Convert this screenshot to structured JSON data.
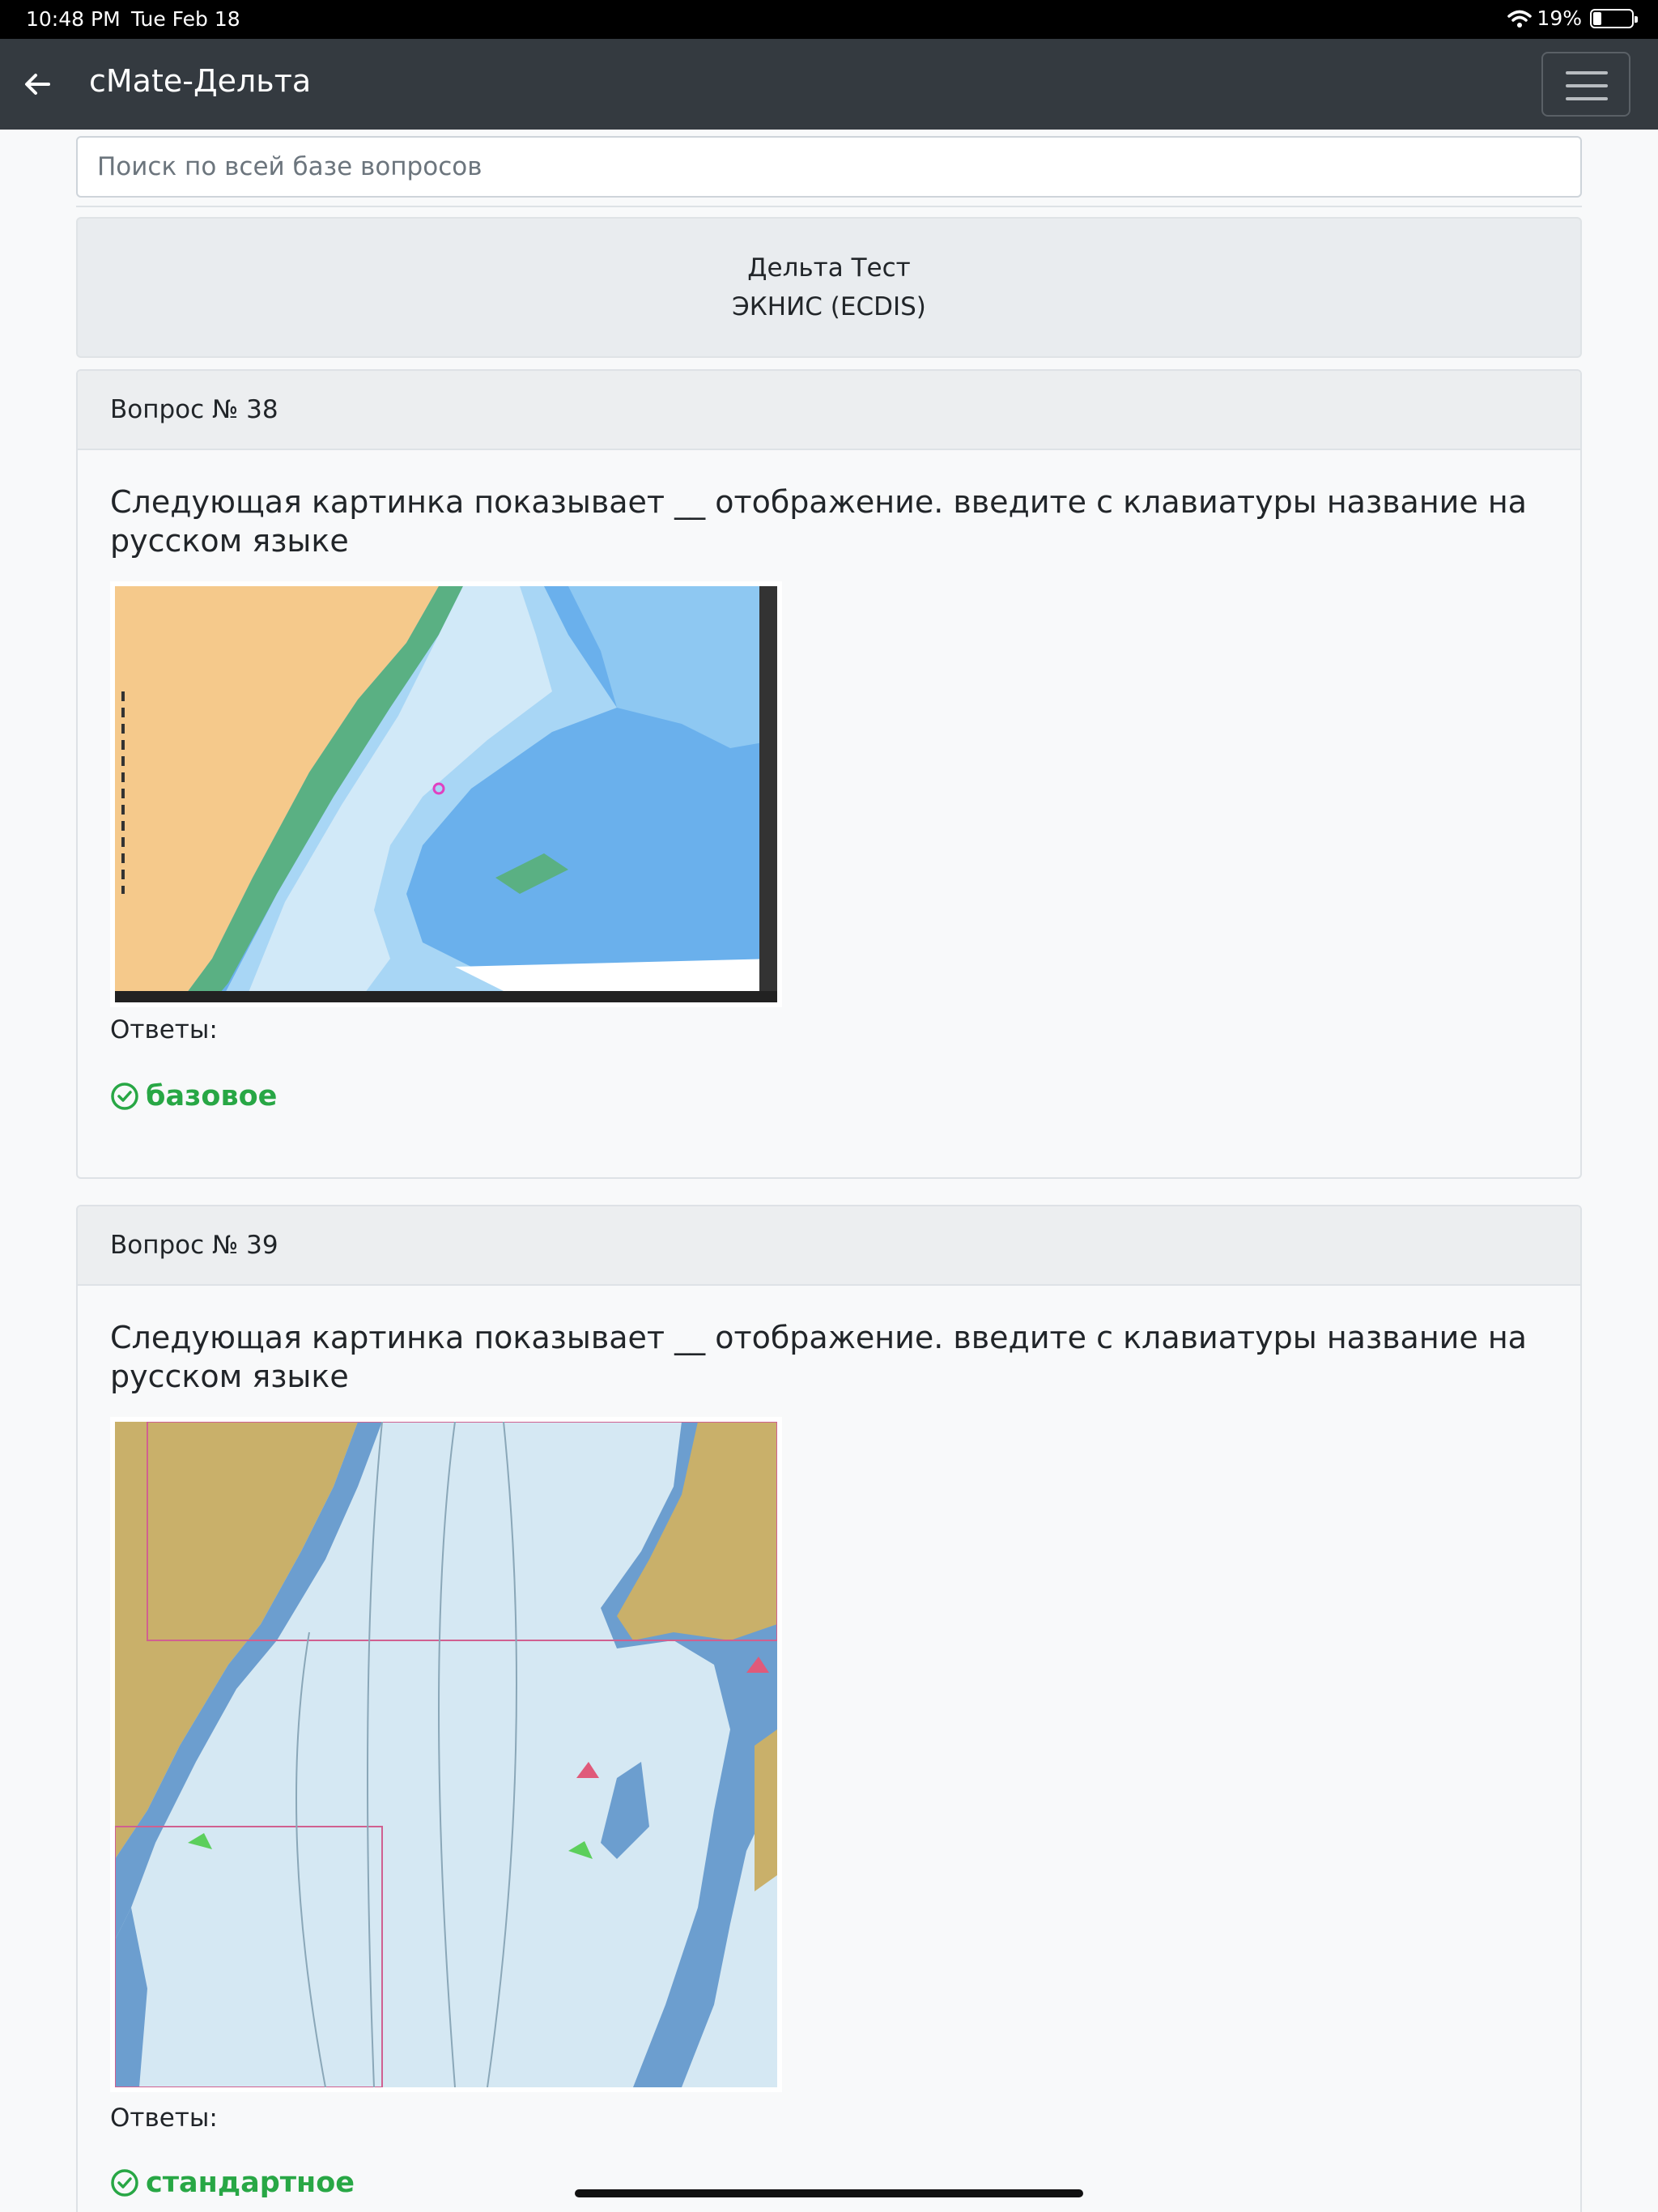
{
  "status": {
    "time": "10:48 PM",
    "date": "Tue Feb 18",
    "battery": "19%",
    "battery_level": 0.19
  },
  "nav": {
    "title": "cMate-Дельта"
  },
  "search": {
    "placeholder": "Поиск по всей базе вопросов"
  },
  "test": {
    "line1": "Дельта Тест",
    "line2": "ЭКНИС (ECDIS)"
  },
  "questions": [
    {
      "header": "Вопрос № 38",
      "text": "Следующая картинка показывает __ отображение. введите с клавиатуры название на русском языке",
      "answers_label": "Ответы:",
      "answer": "базовое"
    },
    {
      "header": "Вопрос № 39",
      "text": "Следующая картинка показывает __ отображение. введите с клавиатуры название на русском языке",
      "answers_label": "Ответы:",
      "answer": "стандартное"
    }
  ],
  "colors": {
    "navbar": "#343a40",
    "correct": "#28a745",
    "land": "#f5c98b",
    "deep_water": "#6ab0ec",
    "shallow_water": "#a8d6f5",
    "green_zone": "#5ab083"
  }
}
